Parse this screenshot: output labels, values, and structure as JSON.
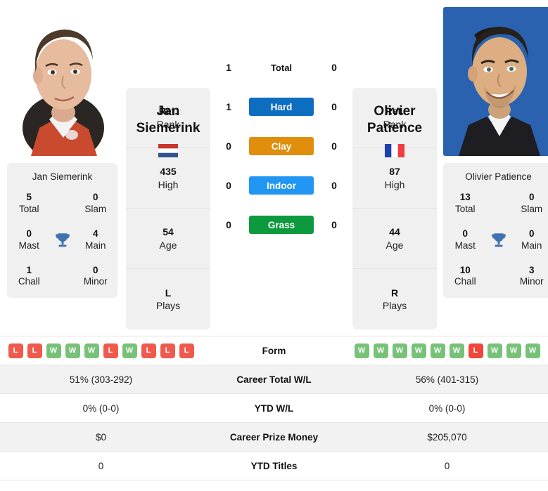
{
  "players": {
    "left": {
      "first_name": "Jan",
      "last_name": "Siemerink",
      "full_name": "Jan Siemerink",
      "country": "Netherlands",
      "flag": "nl-flag-icon",
      "info": [
        {
          "value": "Ret.",
          "label": "Rank"
        },
        {
          "value": "435",
          "label": "High"
        },
        {
          "value": "54",
          "label": "Age"
        },
        {
          "value": "L",
          "label": "Plays"
        }
      ],
      "titles": {
        "total": "5",
        "total_label": "Total",
        "slam": "0",
        "slam_label": "Slam",
        "mast": "0",
        "mast_label": "Mast",
        "main": "4",
        "main_label": "Main",
        "chall": "1",
        "chall_label": "Chall",
        "minor": "0",
        "minor_label": "Minor"
      },
      "form": [
        "L",
        "L",
        "W",
        "W",
        "W",
        "L",
        "W",
        "L",
        "L",
        "L"
      ],
      "career_total_wl": "51% (303-292)",
      "ytd_wl": "0% (0-0)",
      "career_prize_money": "$0",
      "ytd_titles": "0"
    },
    "right": {
      "first_name": "Olivier",
      "last_name": "Patience",
      "full_name": "Olivier Patience",
      "country": "France",
      "flag": "fr-flag-icon",
      "info": [
        {
          "value": "Ret.",
          "label": "Rank"
        },
        {
          "value": "87",
          "label": "High"
        },
        {
          "value": "44",
          "label": "Age"
        },
        {
          "value": "R",
          "label": "Plays"
        }
      ],
      "titles": {
        "total": "13",
        "total_label": "Total",
        "slam": "0",
        "slam_label": "Slam",
        "mast": "0",
        "mast_label": "Mast",
        "main": "0",
        "main_label": "Main",
        "chall": "10",
        "chall_label": "Chall",
        "minor": "3",
        "minor_label": "Minor"
      },
      "form": [
        "W",
        "W",
        "W",
        "W",
        "W",
        "W",
        "L",
        "W",
        "W",
        "W"
      ],
      "career_total_wl": "56% (401-315)",
      "ytd_wl": "0% (0-0)",
      "career_prize_money": "$205,070",
      "ytd_titles": "0"
    }
  },
  "head_to_head": [
    {
      "label": "Total",
      "left": "1",
      "right": "0",
      "color": "transparent",
      "style": "plain"
    },
    {
      "label": "Hard",
      "left": "1",
      "right": "0",
      "color": "#0d6ec0",
      "style": "pill"
    },
    {
      "label": "Clay",
      "left": "0",
      "right": "0",
      "color": "#e08e0b",
      "style": "pill"
    },
    {
      "label": "Indoor",
      "left": "0",
      "right": "0",
      "color": "#2196f3",
      "style": "pill"
    },
    {
      "label": "Grass",
      "left": "0",
      "right": "0",
      "color": "#0d9a3e",
      "style": "pill"
    }
  ],
  "stat_rows": [
    {
      "label": "Form",
      "key": "form",
      "type": "form"
    },
    {
      "label": "Career Total W/L",
      "key": "career_total_wl",
      "type": "text"
    },
    {
      "label": "YTD W/L",
      "key": "ytd_wl",
      "type": "text"
    },
    {
      "label": "Career Prize Money",
      "key": "career_prize_money",
      "type": "text"
    },
    {
      "label": "YTD Titles",
      "key": "ytd_titles",
      "type": "text"
    }
  ],
  "colors": {
    "win": "#77c278",
    "loss": "#ef5a4c",
    "trophy": "#3f72b0",
    "card_bg": "#f0f0f0",
    "row_alt": "#f2f2f2"
  }
}
